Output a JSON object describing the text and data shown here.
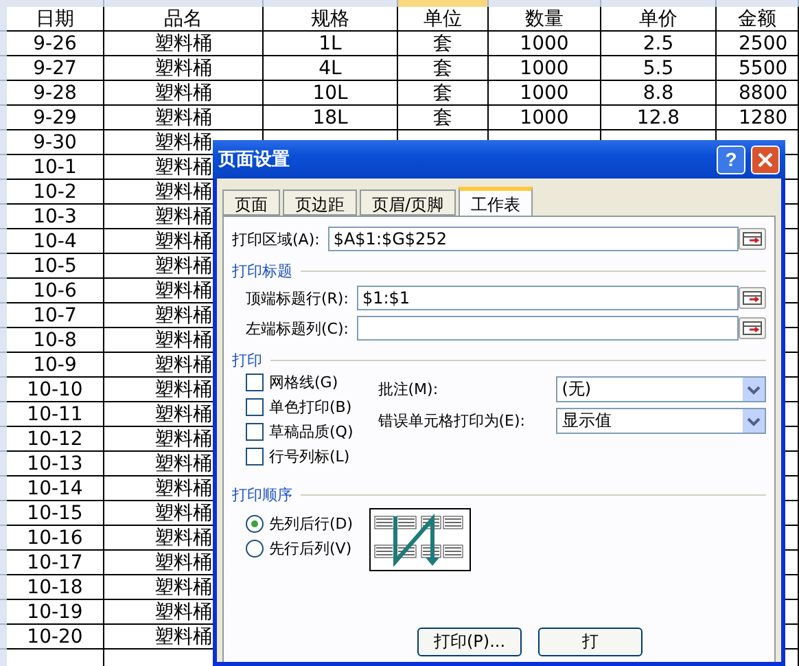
{
  "sheet": {
    "columns": [
      {
        "label": "日期",
        "selected": false
      },
      {
        "label": "品名",
        "selected": false
      },
      {
        "label": "规格",
        "selected": false
      },
      {
        "label": "单位",
        "selected": true
      },
      {
        "label": "数量",
        "selected": false
      },
      {
        "label": "单价",
        "selected": false
      },
      {
        "label": "金额",
        "selected": false
      }
    ],
    "rows": [
      [
        "9-26",
        "塑料桶",
        "1L",
        "套",
        "1000",
        "2.5",
        "2500"
      ],
      [
        "9-27",
        "塑料桶",
        "4L",
        "套",
        "1000",
        "5.5",
        "5500"
      ],
      [
        "9-28",
        "塑料桶",
        "10L",
        "套",
        "1000",
        "8.8",
        "8800"
      ],
      [
        "9-29",
        "塑料桶",
        "18L",
        "套",
        "1000",
        "12.8",
        "1280"
      ],
      [
        "9-30",
        "塑料桶"
      ],
      [
        "10-1",
        "塑料桶"
      ],
      [
        "10-2",
        "塑料桶"
      ],
      [
        "10-3",
        "塑料桶"
      ],
      [
        "10-4",
        "塑料桶"
      ],
      [
        "10-5",
        "塑料桶"
      ],
      [
        "10-6",
        "塑料桶"
      ],
      [
        "10-7",
        "塑料桶"
      ],
      [
        "10-8",
        "塑料桶"
      ],
      [
        "10-9",
        "塑料桶"
      ],
      [
        "10-10",
        "塑料桶"
      ],
      [
        "10-11",
        "塑料桶"
      ],
      [
        "10-12",
        "塑料桶"
      ],
      [
        "10-13",
        "塑料桶"
      ],
      [
        "10-14",
        "塑料桶"
      ],
      [
        "10-15",
        "塑料桶"
      ],
      [
        "10-16",
        "塑料桶"
      ],
      [
        "10-17",
        "塑料桶"
      ],
      [
        "10-18",
        "塑料桶"
      ],
      [
        "10-19",
        "塑料桶"
      ],
      [
        "10-20",
        "塑料桶"
      ]
    ]
  },
  "dialog": {
    "title": "页面设置",
    "help": "?",
    "tabs": [
      {
        "label": "页面",
        "selected": false
      },
      {
        "label": "页边距",
        "selected": false
      },
      {
        "label": "页眉/页脚",
        "selected": false
      },
      {
        "label": "工作表",
        "selected": true
      }
    ],
    "print_area": {
      "label": "打印区域(A):",
      "value": "$A$1:$G$252"
    },
    "titles_section": "打印标题",
    "title_fields": [
      {
        "label": "顶端标题行(R):",
        "value": "$1:$1"
      },
      {
        "label": "左端标题列(C):"
      }
    ],
    "print_section": "打印",
    "checkboxes": [
      {
        "label": "网格线(G)",
        "checked": false
      },
      {
        "label": "单色打印(B)",
        "checked": false
      },
      {
        "label": "草稿品质(Q)",
        "checked": false
      },
      {
        "label": "行号列标(L)",
        "checked": false
      }
    ],
    "dropdowns": [
      {
        "label": "批注(M):",
        "value": "(无)"
      },
      {
        "label": "错误单元格打印为(E):",
        "value": "显示值"
      }
    ],
    "order_section": "打印顺序",
    "order_options": [
      {
        "label": "先列后行(D)",
        "selected": true
      },
      {
        "label": "先行后列(V)",
        "selected": false
      }
    ],
    "buttons": [
      "打印(P)...",
      "打"
    ]
  }
}
